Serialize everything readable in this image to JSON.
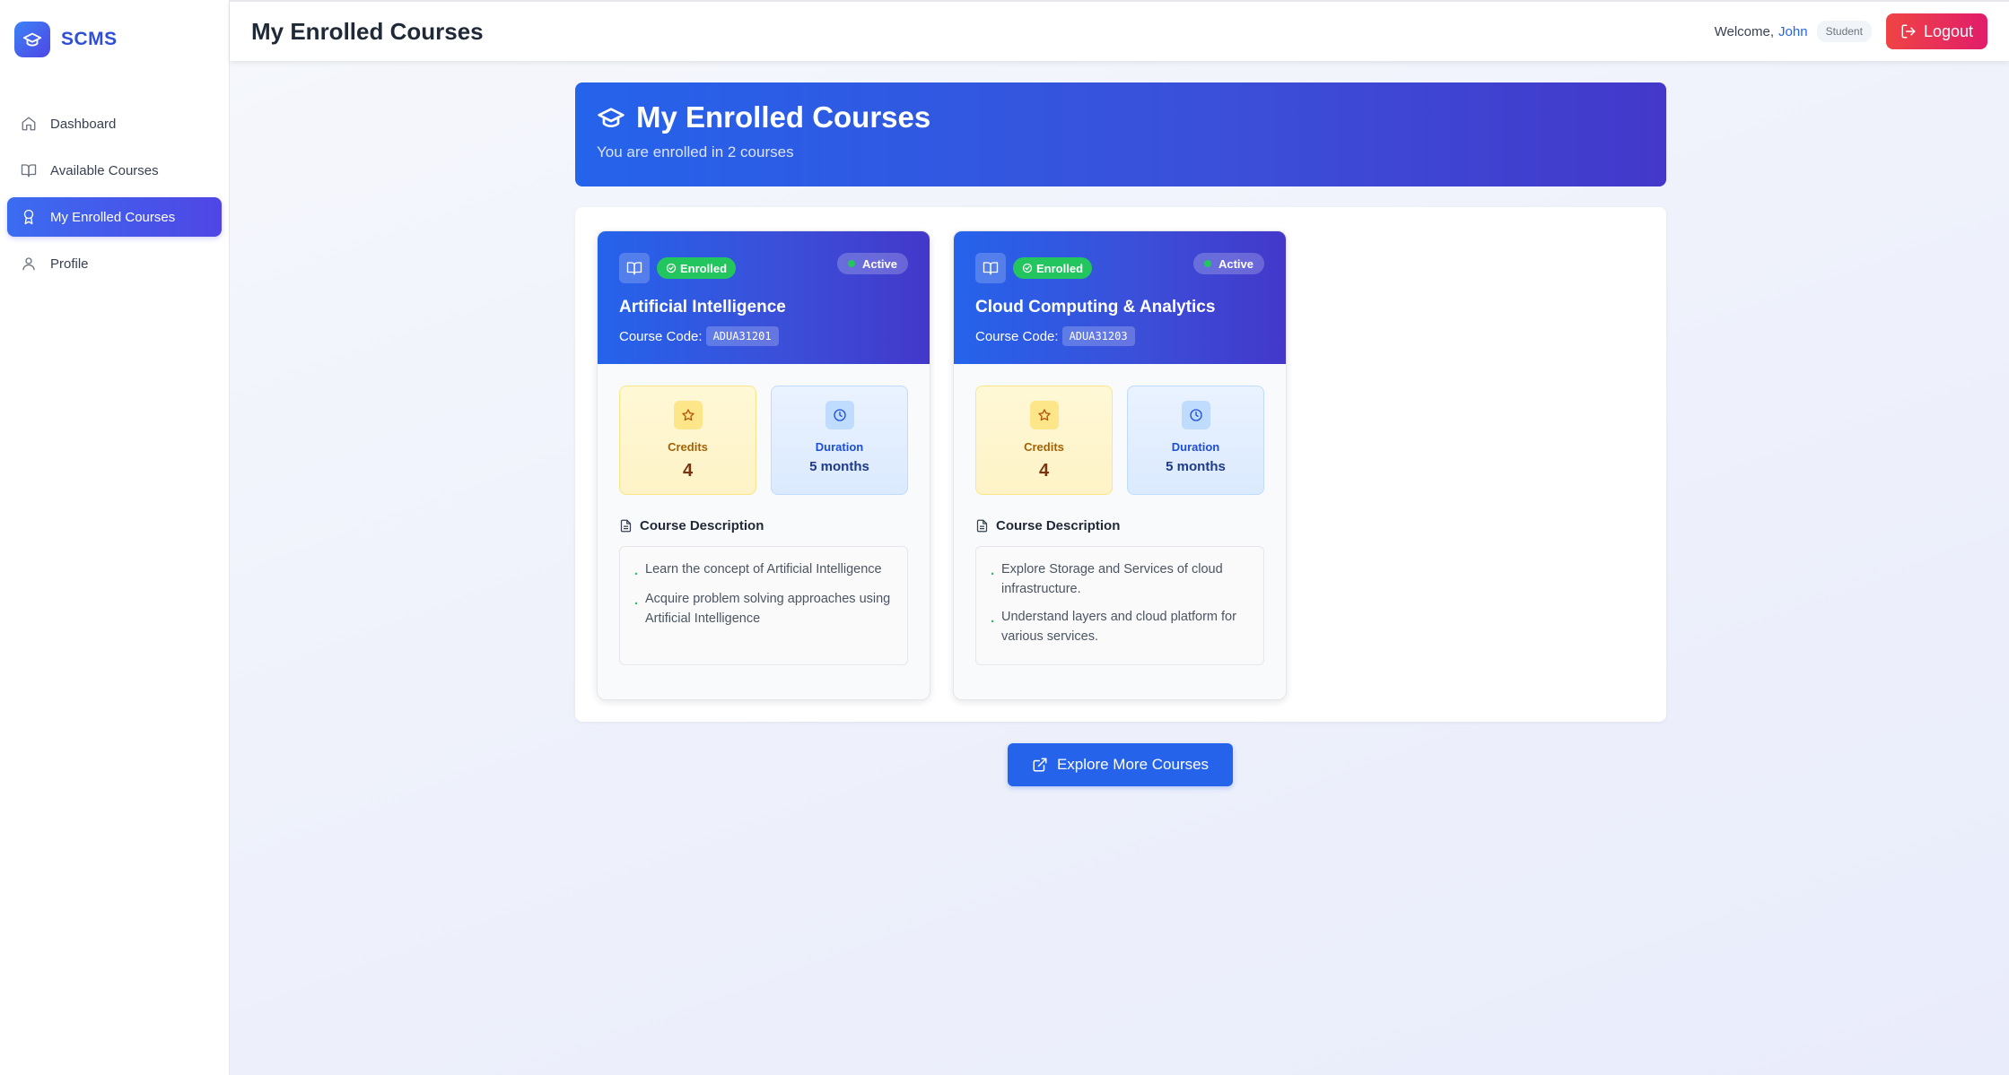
{
  "app": {
    "name": "SCMS"
  },
  "sidebar": {
    "items": [
      {
        "label": "Dashboard",
        "icon": "home-icon"
      },
      {
        "label": "Available Courses",
        "icon": "book-open-icon"
      },
      {
        "label": "My Enrolled Courses",
        "icon": "award-icon",
        "active": true
      },
      {
        "label": "Profile",
        "icon": "user-icon"
      }
    ]
  },
  "header": {
    "title": "My Enrolled Courses",
    "welcome_prefix": "Welcome,",
    "user_name": "John",
    "role": "Student",
    "logout_label": "Logout"
  },
  "hero": {
    "title": "My Enrolled Courses",
    "subtitle": "You are enrolled in 2 courses"
  },
  "courses": [
    {
      "status_enrolled": "Enrolled",
      "status_active": "Active",
      "name": "Artificial Intelligence",
      "code_label": "Course Code:",
      "code": "ADUA31201",
      "credits_label": "Credits",
      "credits": "4",
      "duration_label": "Duration",
      "duration": "5 months",
      "description_title": "Course Description",
      "description": [
        "Learn the concept of Artificial Intelligence",
        "Acquire problem solving approaches using Artificial Intelligence"
      ]
    },
    {
      "status_enrolled": "Enrolled",
      "status_active": "Active",
      "name": "Cloud Computing & Analytics",
      "code_label": "Course Code:",
      "code": "ADUA31203",
      "credits_label": "Credits",
      "credits": "4",
      "duration_label": "Duration",
      "duration": "5 months",
      "description_title": "Course Description",
      "description": [
        "Explore Storage and Services of cloud infrastructure.",
        "Understand layers and cloud platform for various services."
      ]
    }
  ],
  "explore_label": "Explore More Courses",
  "colors": {
    "accent": "#2563eb",
    "accent_dark": "#4338ca",
    "success": "#22c55e",
    "danger": "#ef4444"
  }
}
